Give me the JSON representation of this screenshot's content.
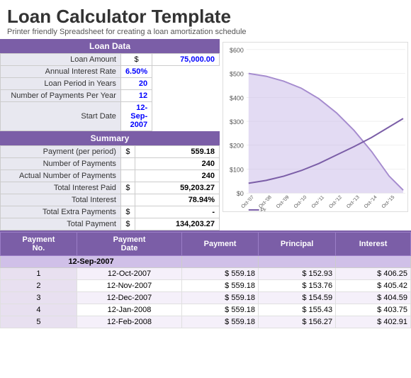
{
  "header": {
    "title": "Loan Calculator Template",
    "subtitle": "Printer friendly Spreadsheet for creating a loan amortization schedule"
  },
  "loan_data": {
    "section_title": "Loan Data",
    "rows": [
      {
        "label": "Loan Amount",
        "dollar": "$",
        "value": "75,000.00",
        "is_blue": true
      },
      {
        "label": "Annual Interest Rate",
        "dollar": "",
        "value": "6.50%",
        "is_blue": true
      },
      {
        "label": "Loan Period in Years",
        "dollar": "",
        "value": "20",
        "is_blue": true
      },
      {
        "label": "Number of Payments Per Year",
        "dollar": "",
        "value": "12",
        "is_blue": true
      },
      {
        "label": "Start Date",
        "dollar": "",
        "value": "12-Sep-2007",
        "is_blue": true
      }
    ]
  },
  "summary": {
    "section_title": "Summary",
    "rows": [
      {
        "label": "Payment (per period)",
        "dollar": "$",
        "value": "559.18",
        "is_blue": false
      },
      {
        "label": "Number of Payments",
        "dollar": "",
        "value": "240",
        "is_blue": false
      },
      {
        "label": "Actual Number of Payments",
        "dollar": "",
        "value": "240",
        "is_blue": false
      },
      {
        "label": "Total Interest Paid",
        "dollar": "$",
        "value": "59,203.27",
        "is_blue": false
      },
      {
        "label": "Total Interest",
        "dollar": "",
        "value": "78.94%",
        "is_blue": false
      },
      {
        "label": "Total Extra Payments",
        "dollar": "$",
        "value": "-",
        "is_blue": false
      },
      {
        "label": "Total Payment",
        "dollar": "$",
        "value": "134,203.27",
        "is_blue": false
      }
    ]
  },
  "amort_table": {
    "headers": [
      "Payment No.",
      "Payment Date",
      "Payment",
      "Principal",
      "Interest"
    ],
    "start_date": "12-Sep-2007",
    "rows": [
      {
        "no": "1",
        "date": "12-Oct-2007",
        "payment": "559.18",
        "principal": "152.93",
        "interest": "406.25"
      },
      {
        "no": "2",
        "date": "12-Nov-2007",
        "payment": "559.18",
        "principal": "153.76",
        "interest": "405.42"
      },
      {
        "no": "3",
        "date": "12-Dec-2007",
        "payment": "559.18",
        "principal": "154.59",
        "interest": "404.59"
      },
      {
        "no": "4",
        "date": "12-Jan-2008",
        "payment": "559.18",
        "principal": "155.43",
        "interest": "403.75"
      },
      {
        "no": "5",
        "date": "12-Feb-2008",
        "payment": "559.18",
        "principal": "156.27",
        "interest": "402.91"
      }
    ]
  },
  "chart": {
    "y_labels": [
      "$600",
      "$500",
      "$400",
      "$300",
      "$200",
      "$100",
      "$0"
    ],
    "x_labels": [
      "Oct-'07",
      "Oct-'08",
      "Oct-'09",
      "Oct-'10",
      "Oct-'11",
      "Oct-'12",
      "Oct-'13",
      "Oct-'14",
      "Oct-'15"
    ],
    "legend": "Pr..."
  }
}
